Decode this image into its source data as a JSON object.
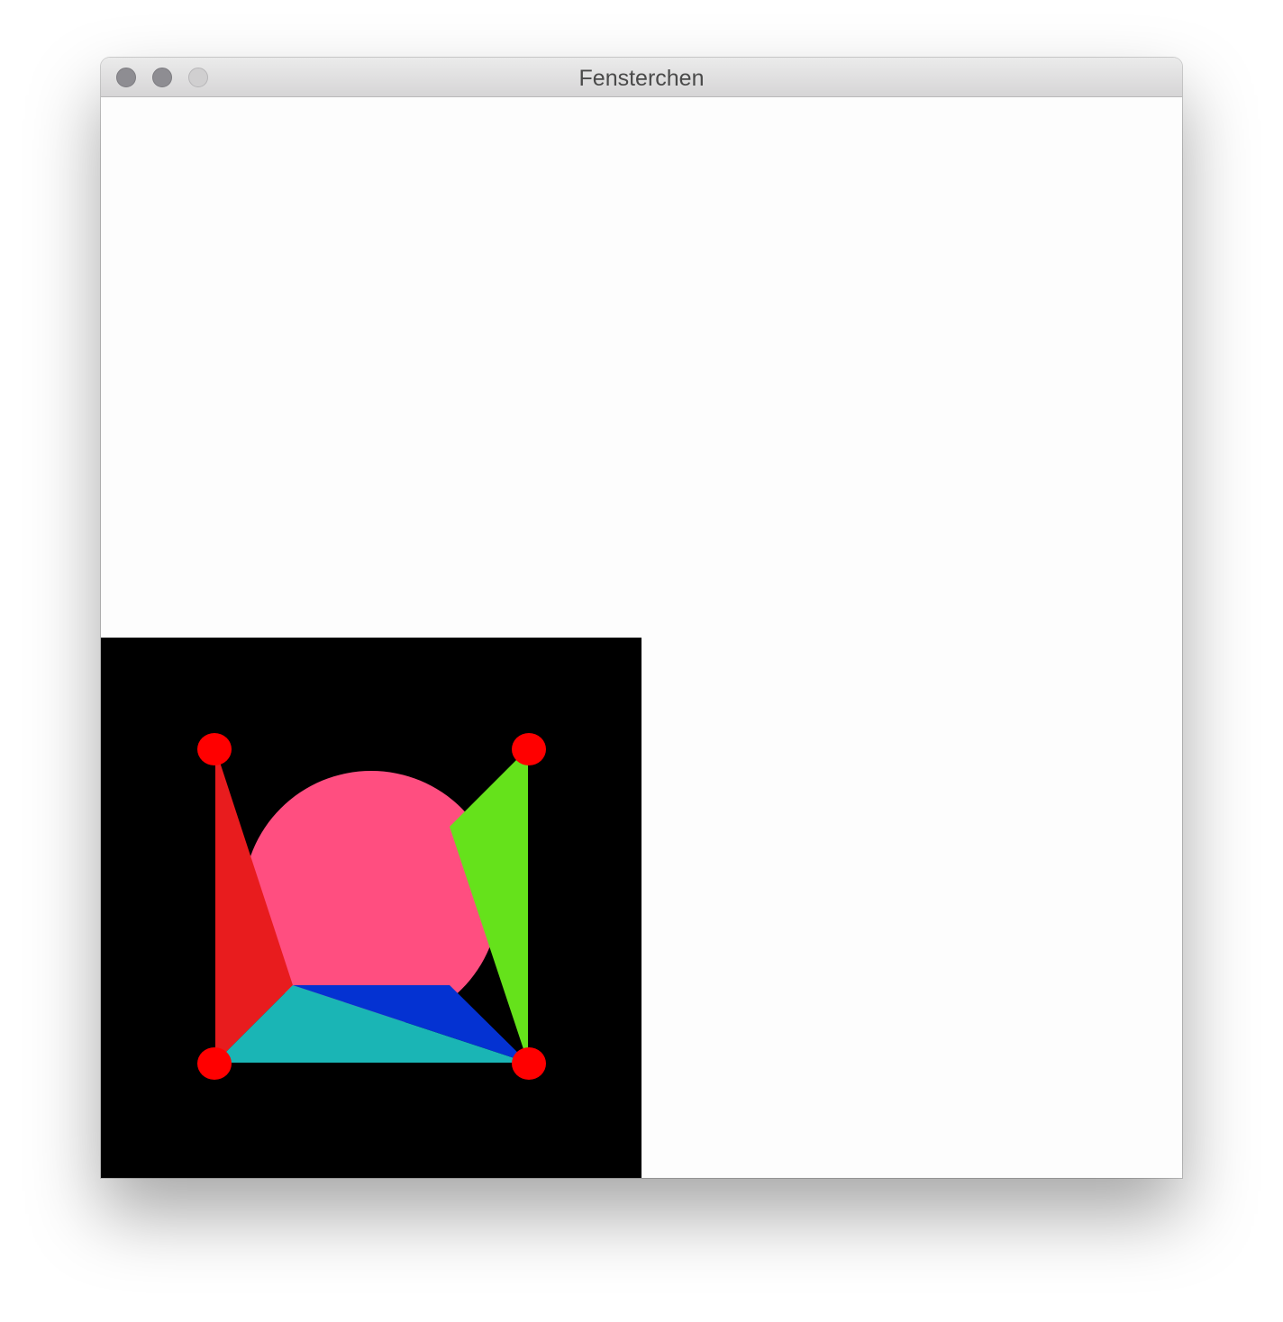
{
  "window": {
    "title": "Fensterchen"
  },
  "scene": {
    "background_color": "#000000",
    "shapes": [
      {
        "name": "pink-circle",
        "color": "#ff4e80"
      },
      {
        "name": "red-triangle",
        "color": "#e81c1e"
      },
      {
        "name": "green-triangle",
        "color": "#65e21b"
      },
      {
        "name": "cyan-triangle",
        "color": "#1ab5b5"
      },
      {
        "name": "blue-triangle",
        "color": "#0432d2"
      },
      {
        "name": "corner-dots",
        "color": "#ff0000"
      }
    ]
  }
}
